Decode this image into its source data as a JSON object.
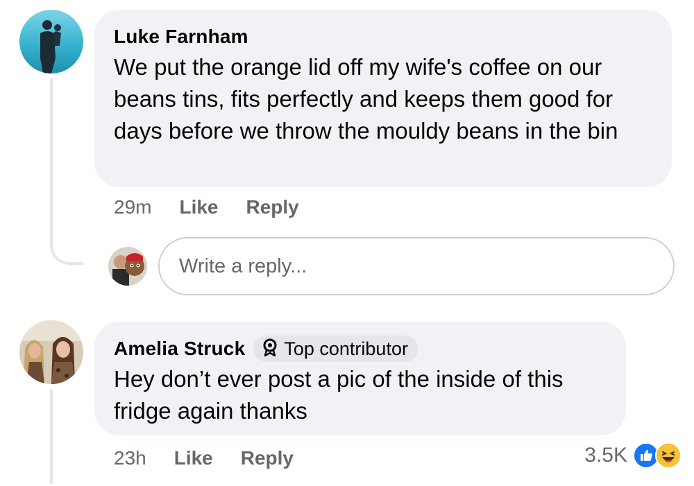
{
  "comments": [
    {
      "author": "Luke Farnham",
      "text": "We put the orange lid off my wife's coffee on our beans tins, fits perfectly and keeps them good for days before we throw the mouldy beans in the bin",
      "time": "29m",
      "like_label": "Like",
      "reply_label": "Reply"
    },
    {
      "author": "Amelia Struck",
      "badge": "Top contributor",
      "text": "Hey don’t ever post a pic of the inside of this fridge again thanks",
      "time": "23h",
      "like_label": "Like",
      "reply_label": "Reply",
      "reaction_count": "3.5K",
      "reaction_icons": [
        "like-reaction-icon",
        "haha-reaction-icon"
      ]
    }
  ],
  "reply_box": {
    "placeholder": "Write a reply..."
  },
  "colors": {
    "bubble": "#f0f2f5",
    "secondary_text": "#65676b",
    "like_blue": "#1877f2",
    "haha_yellow": "#f7b125"
  }
}
